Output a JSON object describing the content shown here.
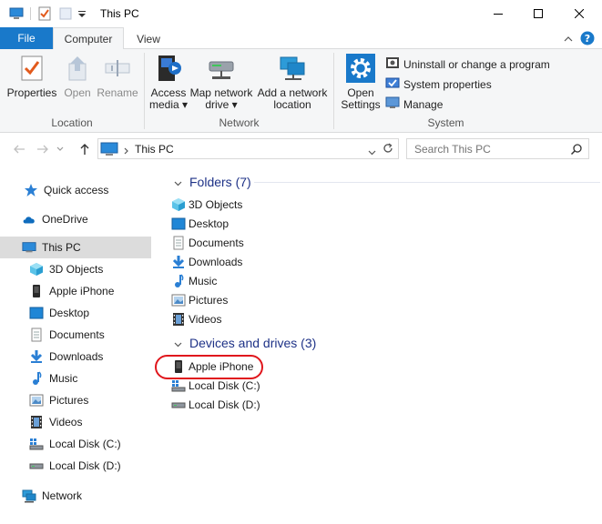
{
  "window": {
    "title": "This PC"
  },
  "tabs": {
    "file": "File",
    "computer": "Computer",
    "view": "View"
  },
  "ribbon": {
    "location": {
      "label": "Location",
      "properties": "Properties",
      "open": "Open",
      "rename": "Rename"
    },
    "network": {
      "label": "Network",
      "access_media": [
        "Access",
        "media"
      ],
      "map_network_drive": [
        "Map network",
        "drive"
      ],
      "add_network_location": [
        "Add a network",
        "location"
      ]
    },
    "system": {
      "label": "System",
      "open_settings": [
        "Open",
        "Settings"
      ],
      "uninstall": "Uninstall or change a program",
      "system_properties": "System properties",
      "manage": "Manage"
    }
  },
  "address": {
    "path": "This PC",
    "search_placeholder": "Search This PC"
  },
  "nav": {
    "quick_access": "Quick access",
    "onedrive": "OneDrive",
    "this_pc": "This PC",
    "children": [
      "3D Objects",
      "Apple iPhone",
      "Desktop",
      "Documents",
      "Downloads",
      "Music",
      "Pictures",
      "Videos",
      "Local Disk (C:)",
      "Local Disk (D:)"
    ],
    "network": "Network"
  },
  "content": {
    "folders_header": "Folders (7)",
    "folders": [
      "3D Objects",
      "Desktop",
      "Documents",
      "Downloads",
      "Music",
      "Pictures",
      "Videos"
    ],
    "devices_header": "Devices and drives (3)",
    "devices": [
      "Apple iPhone",
      "Local Disk (C:)",
      "Local Disk (D:)"
    ]
  },
  "colors": {
    "accent": "#1979ca",
    "group_header": "#1e3287",
    "highlight_ring": "#e0161c",
    "selected": "#dcdcdc"
  }
}
